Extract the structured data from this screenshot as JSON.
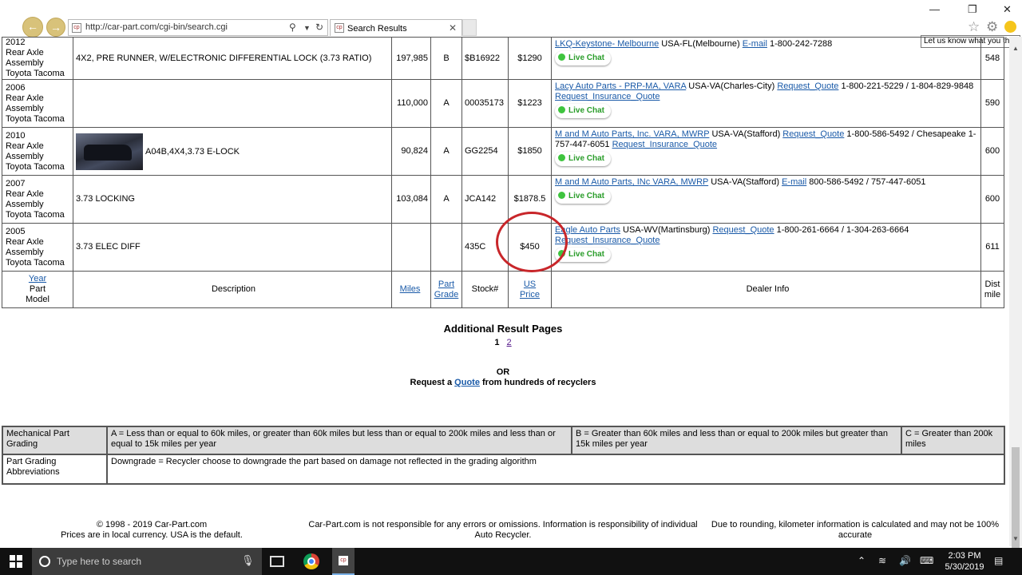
{
  "browser": {
    "url": "http://car-part.com/cgi-bin/search.cgi",
    "tab_title": "Search Results",
    "tooltip": "Let us know what you think"
  },
  "rows": [
    {
      "year": "2012",
      "part": "Rear Axle Assembly",
      "model": "Toyota Tacoma",
      "description": "4X2, PRE RUNNER, W/ELECTRONIC DIFFERENTIAL LOCK (3.73 RATIO)",
      "miles": "197,985",
      "grade": "B",
      "stock": "$B16922",
      "price": "$1290",
      "dealer_name": "LKQ-Keystone- Melbourne",
      "dealer_loc": " USA-FL(Melbourne) ",
      "link1": "E-mail",
      "phone": " 1-800-242-7288",
      "link2": "",
      "dist": "548"
    },
    {
      "year": "2006",
      "part": "Rear Axle Assembly",
      "model": "Toyota Tacoma",
      "description": "",
      "miles": "110,000",
      "grade": "A",
      "stock": "00035173",
      "price": "$1223",
      "dealer_name": "Lacy Auto Parts - PRP-MA, VARA",
      "dealer_loc": " USA-VA(Charles-City) ",
      "link1": "Request_Quote",
      "phone": " 1-800-221-5229 / 1-804-829-9848 ",
      "link2": "Request_Insurance_Quote",
      "dist": "590"
    },
    {
      "year": "2010",
      "part": "Rear Axle Assembly",
      "model": "Toyota Tacoma",
      "description": "A04B,4X4,3.73 E-LOCK",
      "miles": "90,824",
      "grade": "A",
      "stock": "GG2254",
      "price": "$1850",
      "dealer_name": "M and M Auto Parts, Inc. VARA, MWRP",
      "dealer_loc": " USA-VA(Stafford) ",
      "link1": "Request_Quote",
      "phone": " 1-800-586-5492 / Chesapeake 1-757-447-6051 ",
      "link2": "Request_Insurance_Quote",
      "dist": "600"
    },
    {
      "year": "2007",
      "part": "Rear Axle Assembly",
      "model": "Toyota Tacoma",
      "description": "3.73 LOCKING",
      "miles": "103,084",
      "grade": "A",
      "stock": "JCA142",
      "price": "$1878.5",
      "dealer_name": "M and M Auto Parts, INc VARA, MWRP",
      "dealer_loc": " USA-VA(Stafford) ",
      "link1": "E-mail",
      "phone": " 800-586-5492 / 757-447-6051",
      "link2": "",
      "dist": "600"
    },
    {
      "year": "2005",
      "part": "Rear Axle Assembly",
      "model": "Toyota Tacoma",
      "description": "3.73 ELEC DIFF",
      "miles": "",
      "grade": "",
      "stock": "435C",
      "price": "$450",
      "dealer_name": "Eagle Auto Parts",
      "dealer_loc": " USA-WV(Martinsburg) ",
      "link1": "Request_Quote",
      "phone": " 1-800-261-6664 / 1-304-263-6664 ",
      "link2": "Request_Insurance_Quote",
      "dist": "611"
    }
  ],
  "live_chat": "Live Chat",
  "header": {
    "year": "Year",
    "part": "Part",
    "model": "Model",
    "description": "Description",
    "miles": "Miles",
    "grade1": "Part",
    "grade2": "Grade",
    "stock": "Stock#",
    "price1": "US",
    "price2": "Price",
    "dealer": "Dealer Info",
    "dist1": "Dist",
    "dist2": "mile"
  },
  "additional": {
    "title": "Additional Result Pages",
    "page1": "1",
    "page2": "2"
  },
  "or_text": "OR",
  "request": {
    "pre": "Request a ",
    "link": "Quote",
    "post": " from hundreds of recyclers"
  },
  "grading": {
    "r1c1": "Mechanical Part Grading",
    "r1c2": "A = Less than or equal to 60k miles, or greater than 60k miles but less than or equal to 200k miles and less than or equal to 15k miles per year",
    "r1c3": "B = Greater than 60k miles and less than or equal to 200k miles but greater than 15k miles per year",
    "r1c4": "C = Greater than 200k miles",
    "r2c1": "Part Grading Abbreviations",
    "r2c2": "Downgrade = Recycler choose to downgrade the part based on damage not reflected in the grading algorithm"
  },
  "footer": {
    "copyright": "© 1998 - 2019 Car-Part.com",
    "currency": "Prices are in local currency. USA is the default.",
    "disclaimer": "Car-Part.com is not responsible for any errors or omissions. Information is responsibility of individual Auto Recycler.",
    "rounding": "Due to rounding, kilometer information is calculated and may not be 100% accurate"
  },
  "taskbar": {
    "search_placeholder": "Type here to search",
    "time": "2:03 PM",
    "date": "5/30/2019"
  },
  "colors": {
    "link": "#1a5aa8",
    "annotation_circle": "#c8262a",
    "live_chat_green": "#2a9d2a"
  }
}
